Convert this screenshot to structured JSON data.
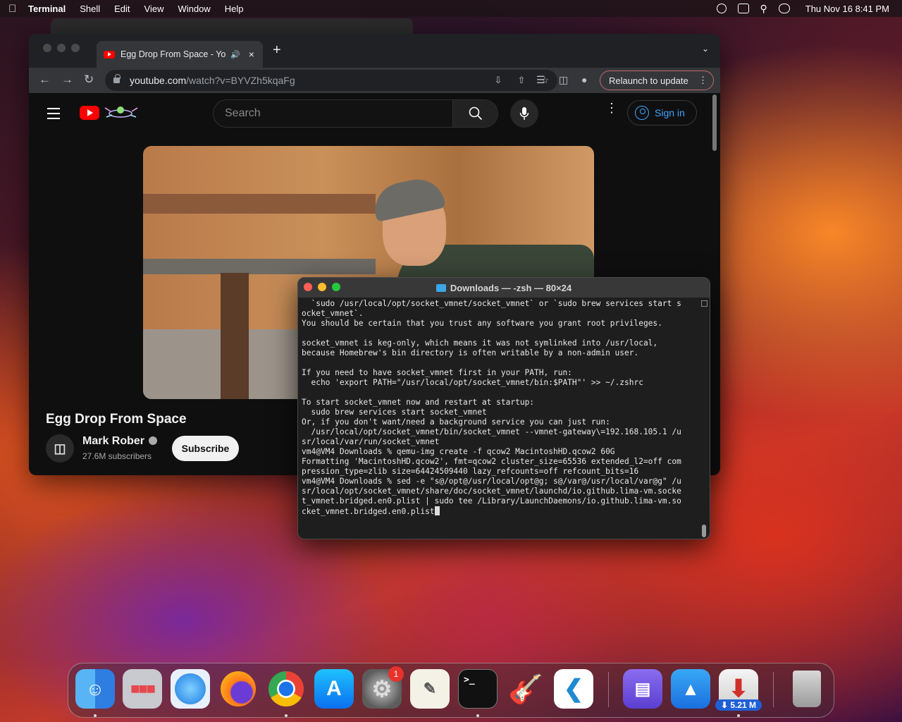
{
  "menubar": {
    "app_name": "Terminal",
    "menus": [
      "Shell",
      "Edit",
      "View",
      "Window",
      "Help"
    ],
    "datetime": "Thu Nov 16  8:41 PM",
    "status_icons": [
      "play-circle-icon",
      "screen-mirror-icon",
      "spotlight-search-icon",
      "control-center-icon"
    ]
  },
  "browser": {
    "tab": {
      "title": "Egg Drop From Space - YouTube",
      "audio_icon": "speaker-icon",
      "close": "×"
    },
    "new_tab": "+",
    "url": {
      "host": "youtube.com",
      "path": "/watch?v=BYVZh5kqaFg"
    },
    "relaunch_label": "Relaunch to update",
    "youtube": {
      "search_placeholder": "Search",
      "signin_label": "Sign in",
      "video_title": "Egg Drop From Space",
      "channel_name": "Mark Rober",
      "subscribers": "27.6M subscribers",
      "subscribe_label": "Subscribe"
    }
  },
  "terminal": {
    "title": "Downloads — -zsh — 80×24",
    "lines": [
      "  `sudo /usr/local/opt/socket_vmnet/socket_vmnet` or `sudo brew services start s",
      "ocket_vmnet`.",
      "You should be certain that you trust any software you grant root privileges.",
      "",
      "socket_vmnet is keg-only, which means it was not symlinked into /usr/local,",
      "because Homebrew's bin directory is often writable by a non-admin user.",
      "",
      "If you need to have socket_vmnet first in your PATH, run:",
      "  echo 'export PATH=\"/usr/local/opt/socket_vmnet/bin:$PATH\"' >> ~/.zshrc",
      "",
      "To start socket_vmnet now and restart at startup:",
      "  sudo brew services start socket_vmnet",
      "Or, if you don't want/need a background service you can just run:",
      "  /usr/local/opt/socket_vmnet/bin/socket_vmnet --vmnet-gateway\\=192.168.105.1 /u",
      "sr/local/var/run/socket_vmnet",
      "vm4@VM4 Downloads % qemu-img create -f qcow2 MacintoshHD.qcow2 60G",
      "Formatting 'MacintoshHD.qcow2', fmt=qcow2 cluster_size=65536 extended_l2=off com",
      "pression_type=zlib size=64424509440 lazy_refcounts=off refcount_bits=16",
      "vm4@VM4 Downloads % sed -e \"s@/opt@/usr/local/opt@g; s@/var@/usr/local/var@g\" /u",
      "sr/local/opt/socket_vmnet/share/doc/socket_vmnet/launchd/io.github.lima-vm.socke",
      "t_vmnet.bridged.en0.plist | sudo tee /Library/LaunchDaemons/io.github.lima-vm.so",
      "cket_vmnet.bridged.en0.plist"
    ]
  },
  "dock": {
    "apps": [
      "Finder",
      "Launchpad",
      "Safari",
      "Firefox",
      "Google Chrome",
      "App Store",
      "System Settings",
      "TextEdit",
      "Terminal",
      "GarageBand",
      "Visual Studio Code",
      "Apple Configurator",
      "Keynote",
      "Downloader",
      "Trash"
    ],
    "settings_badge": "1",
    "download_badge": "⬇ 5.21 M"
  }
}
